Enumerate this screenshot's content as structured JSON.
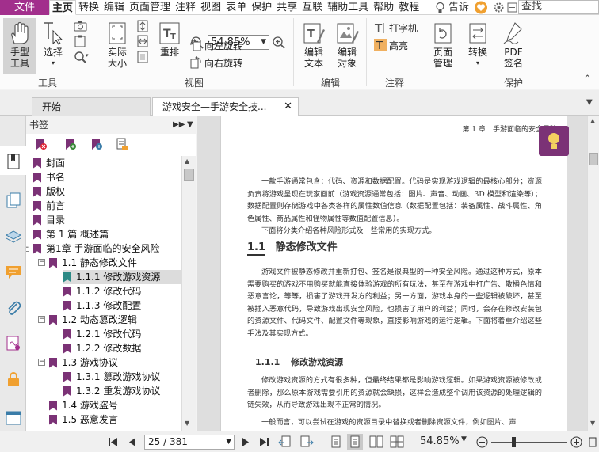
{
  "menubar": {
    "file": "文件",
    "items": [
      "主页",
      "转换",
      "编辑",
      "页面管理",
      "注释",
      "视图",
      "表单",
      "保护",
      "共享",
      "互联",
      "辅助工具",
      "帮助",
      "教程"
    ],
    "tell_me": "告诉",
    "search_placeholder": "查找"
  },
  "ribbon": {
    "hand_tool": "手型工具",
    "select": "选择",
    "actual_size": "实际大小",
    "reflow": "重排",
    "zoom_value": "54.85%",
    "rotate_left": "向左旋转",
    "rotate_right": "向右旋转",
    "edit_text": "编辑文本",
    "edit_object": "编辑对象",
    "typewriter": "打字机",
    "highlight": "高亮",
    "page_manage": "页面管理",
    "convert": "转换",
    "pdf_sign": "PDF签名",
    "groups": {
      "tools": "工具",
      "view": "视图",
      "edit": "编辑",
      "comment": "注释",
      "protect": "保护"
    }
  },
  "tabs": {
    "start": "开始",
    "doc": "游戏安全—手游安全技..."
  },
  "bookmarks": {
    "title": "书签",
    "items": [
      {
        "label": "封面",
        "level": 0,
        "color": "purple"
      },
      {
        "label": "书名",
        "level": 0,
        "color": "purple"
      },
      {
        "label": "版权",
        "level": 0,
        "color": "purple"
      },
      {
        "label": "前言",
        "level": 0,
        "color": "purple"
      },
      {
        "label": "目录",
        "level": 0,
        "color": "purple"
      },
      {
        "label": "第 1 篇 概述篇",
        "level": 0,
        "color": "purple"
      },
      {
        "label": "第1章 手游面临的安全风险",
        "level": 0,
        "color": "purple",
        "expanded": true
      },
      {
        "label": "1.1 静态修改文件",
        "level": 1,
        "color": "purple",
        "expanded": true
      },
      {
        "label": "1.1.1 修改游戏资源",
        "level": 2,
        "color": "teal",
        "selected": true
      },
      {
        "label": "1.1.2 修改代码",
        "level": 2,
        "color": "purple"
      },
      {
        "label": "1.1.3 修改配置",
        "level": 2,
        "color": "purple"
      },
      {
        "label": "1.2 动态篡改逻辑",
        "level": 1,
        "color": "purple",
        "expanded": true
      },
      {
        "label": "1.2.1 修改代码",
        "level": 2,
        "color": "purple"
      },
      {
        "label": "1.2.2 修改数据",
        "level": 2,
        "color": "purple"
      },
      {
        "label": "1.3 游戏协议",
        "level": 1,
        "color": "purple",
        "expanded": true
      },
      {
        "label": "1.3.1 篡改游戏协议",
        "level": 2,
        "color": "purple"
      },
      {
        "label": "1.3.2 重发游戏协议",
        "level": 2,
        "color": "purple"
      },
      {
        "label": "1.4 游戏盗号",
        "level": 1,
        "color": "purple"
      },
      {
        "label": "1.5 恶意发言",
        "level": 1,
        "color": "purple"
      }
    ]
  },
  "document": {
    "running_header": "第 1 章　手游面临的安全风险",
    "para1": "一款手游通常包含：代码、资源和数据配置。代码是实现游戏逻辑的最核心部分；资源负责将游戏呈现在玩家面前（游戏资源通常包括：图片、声音、动画、3D 模型和渲染等）；数据配置则存储游戏中各类各样的属性数值信息（数据配置包括：装备属性、战斗属性、角色属性、商品属性和怪物属性等数值配置信息）。",
    "para2": "下面将分类介绍各种风险形式及一些常用的实现方式。",
    "section_num": "1.1",
    "section_title": "静态修改文件",
    "para3": "游戏文件被静态修改并重新打包、签名是很典型的一种安全风险。通过这种方式，原本需要购买的游戏不用购买就能直接体验游戏的所有玩法，甚至在游戏中打广告、散播色情和恶意言论，等等，损害了游戏开发方的利益；另一方面，游戏本身的一些逻辑被破坏，甚至被插入恶意代码，导致游戏出现安全风险，也损害了用户的利益；同时，会存在修改安装包的资源文件、代码文件、配置文件等现象，直接影响游戏的运行逻辑。下面将着重介绍这些手法及其实现方式。",
    "subsection_num": "1.1.1",
    "subsection_title": "修改游戏资源",
    "para4": "修改游戏资源的方式有很多种，但最终结果都是影响游戏逻辑。如果游戏资源被修改或者删除，那么原本游戏需要引用的资源就会缺损，这样会造成整个调用该资源的处理逻辑的链失效，从而导致游戏出现不正常的情况。",
    "para5": "一般而言，可以尝试在游戏的资源目录中替换或者删除资源文件，例如图片、声"
  },
  "statusbar": {
    "page": "25 / 381",
    "zoom": "54.85%"
  },
  "colors": {
    "accent": "#a22f8c",
    "bookmark": "#7b3276",
    "selected_bookmark": "#2d8a86"
  }
}
